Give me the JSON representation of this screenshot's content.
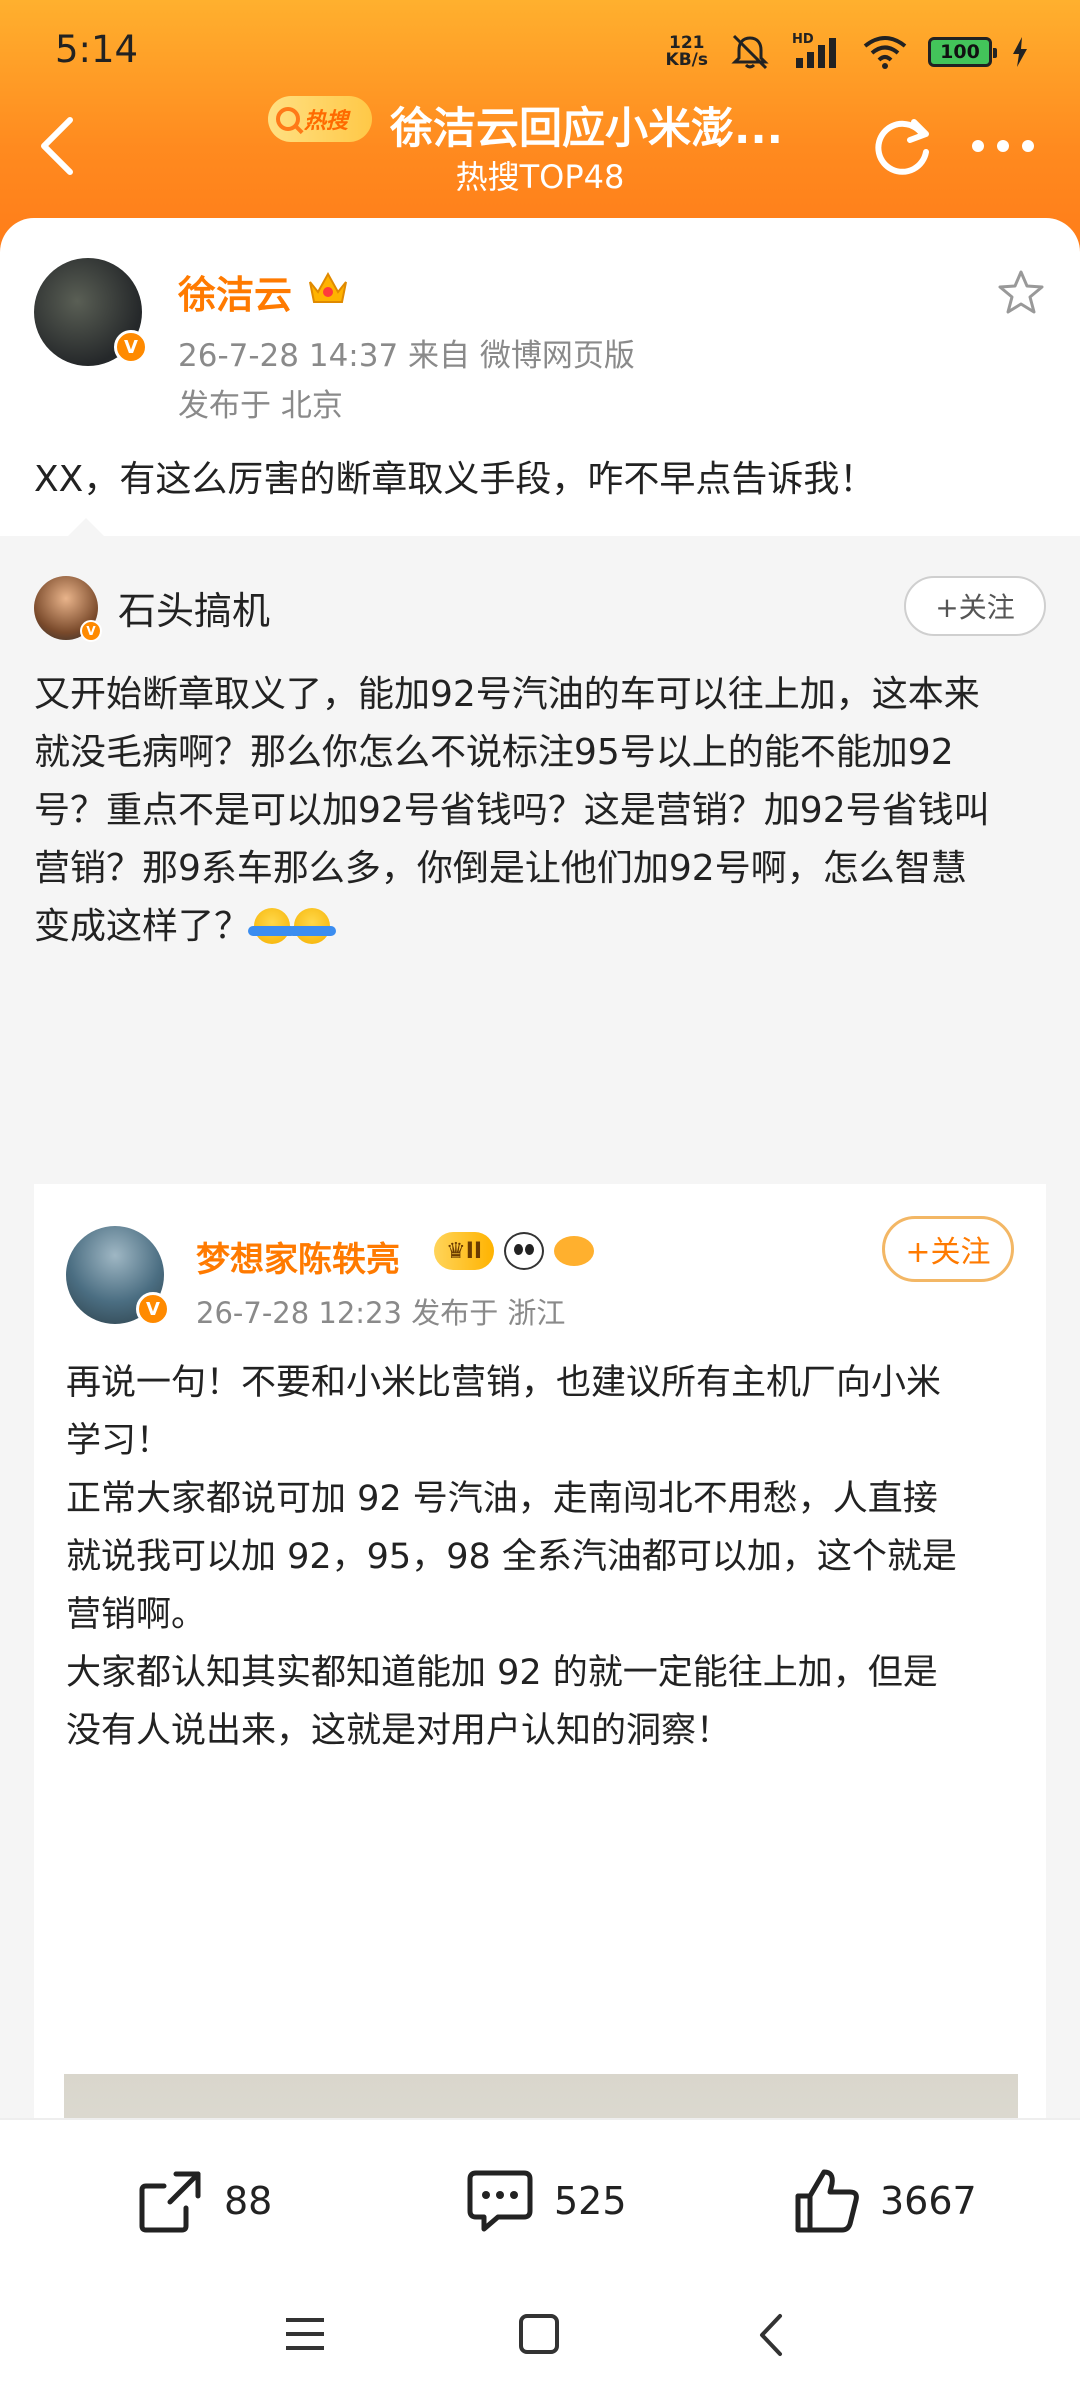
{
  "status_bar": {
    "time": "5:14",
    "net_speed_value": "121",
    "net_speed_unit": "KB/s",
    "hd_label": "HD",
    "battery": "100"
  },
  "nav": {
    "hot_badge": "热搜",
    "title": "徐洁云回应小米澎...",
    "subtitle": "热搜TOP48"
  },
  "original_post": {
    "author": "徐洁云",
    "avatar_badge": "V",
    "meta": "26-7-28 14:37  来自 微博网页版",
    "location": "发布于 北京",
    "text": "XX，有这么厉害的断章取义手段，咋不早点告诉我！"
  },
  "repost": {
    "author": "石头搞机",
    "avatar_badge": "V",
    "follow_label": "+关注",
    "lines": [
      "又开始断章取义了，能加92号汽油的车可以往上加，这本来",
      "就没毛病啊？那么你怎么不说标注95号以上的能不能加92",
      "号？重点不是可以加92号省钱吗？这是营销？加92号省钱叫",
      "营销？那9系车那么多，你倒是让他们加92号啊，怎么智慧",
      "变成这样了？"
    ]
  },
  "quoted_post": {
    "author": "梦想家陈轶亮",
    "avatar_badge": "V",
    "vip_badge": "II",
    "meta": "26-7-28 12:23  发布于 浙江",
    "follow_label": "+关注",
    "lines": [
      "再说一句！不要和小米比营销，也建议所有主机厂向小米",
      "学习！",
      "正常大家都说可加 92 号汽油，走南闯北不用愁，人直接",
      "就说我可以加 92，95，98 全系汽油都可以加，这个就是",
      "营销啊。",
      "大家都认知其实都知道能加 92 的就一定能往上加，但是",
      "没有人说出来，这就是对用户认知的洞察！"
    ]
  },
  "actions": {
    "share_count": "88",
    "comment_count": "525",
    "like_count": "3667"
  },
  "colors": {
    "header_gradient_top": "#ffb02e",
    "header_gradient_bottom": "#ff7a18",
    "name_orange": "#ff7a00",
    "meta_gray": "#8a8a8a"
  }
}
